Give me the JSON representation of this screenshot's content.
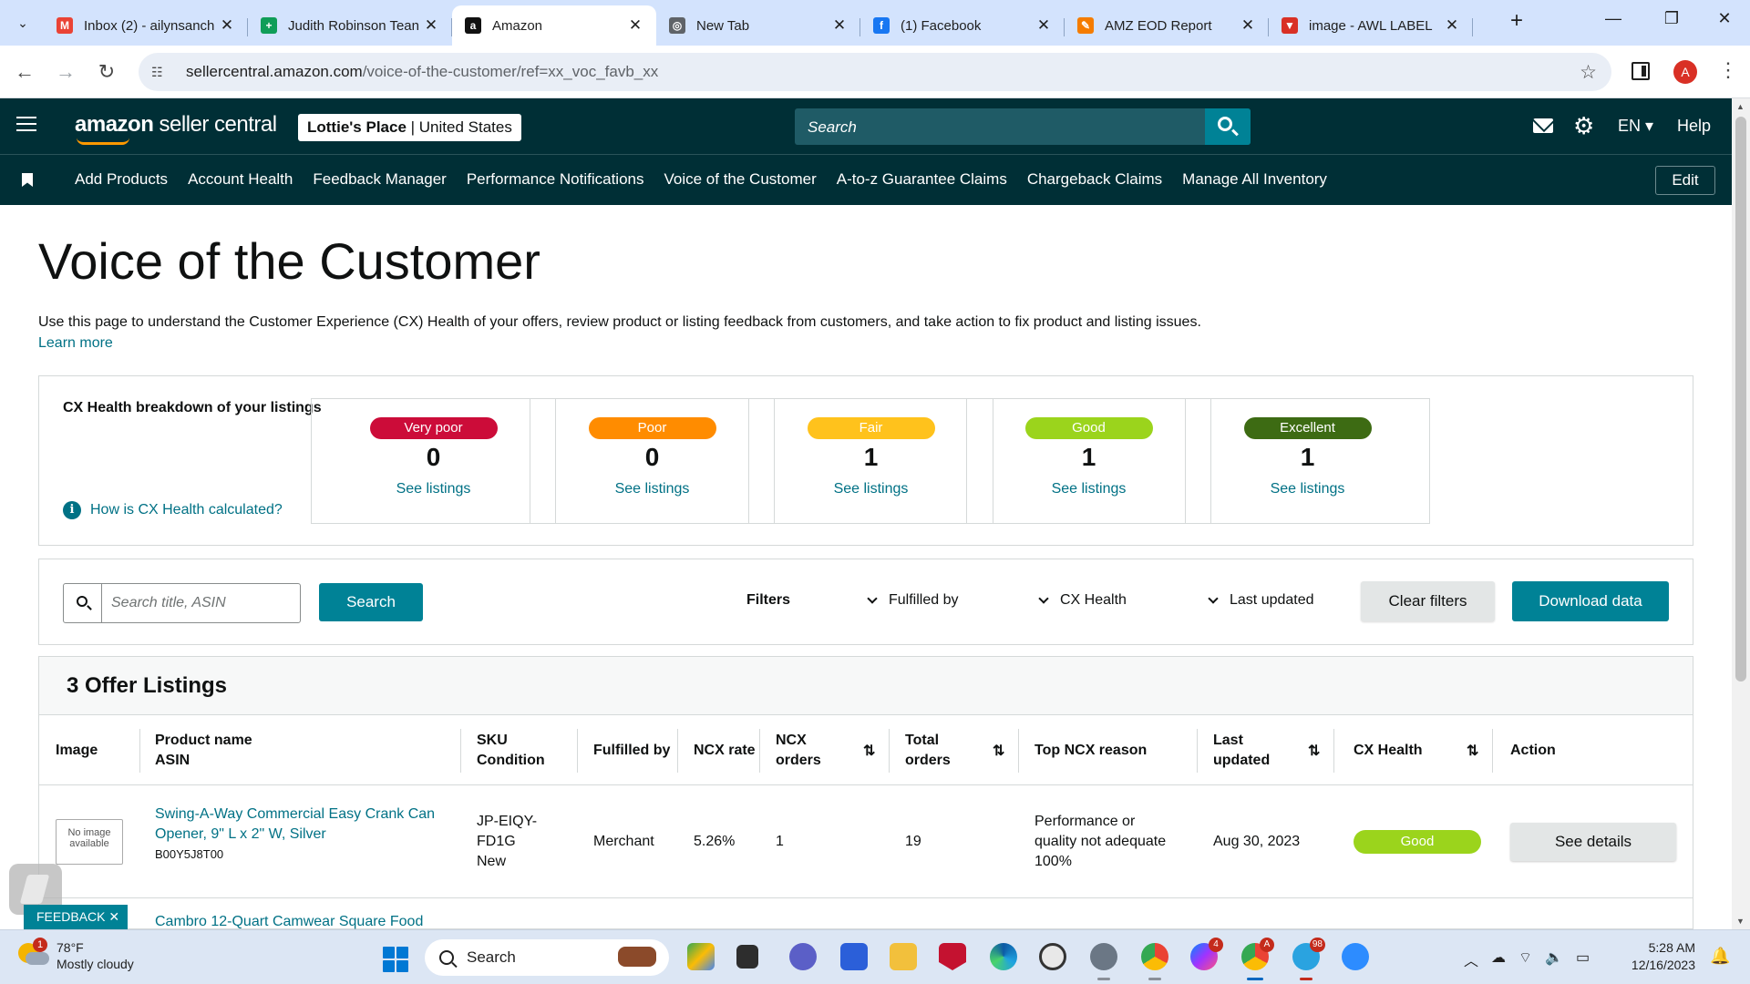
{
  "browser": {
    "tabs": [
      {
        "title": "Inbox (2) - ailynsanch",
        "favicon": "gmail-icon",
        "color": "#ea4335",
        "glyph": "M",
        "active": false
      },
      {
        "title": "Judith Robinson Tean",
        "favicon": "sheets-icon",
        "color": "#0f9d58",
        "glyph": "+",
        "active": false
      },
      {
        "title": "Amazon",
        "favicon": "amazon-icon",
        "color": "#111111",
        "glyph": "a",
        "active": true
      },
      {
        "title": "New Tab",
        "favicon": "chrome-icon",
        "color": "#5f6368",
        "glyph": "◎",
        "active": false
      },
      {
        "title": "(1) Facebook",
        "favicon": "facebook-icon",
        "color": "#1877f2",
        "glyph": "f",
        "active": false
      },
      {
        "title": "AMZ EOD Report",
        "favicon": "tool-icon",
        "color": "#f57c00",
        "glyph": "✎",
        "active": false
      },
      {
        "title": "image - AWL LABEL",
        "favicon": "drive-icon",
        "color": "#d93025",
        "glyph": "▼",
        "active": false
      }
    ],
    "url_host": "sellercentral.amazon.com",
    "url_path": "/voice-of-the-customer/ref=xx_voc_favb_xx",
    "profile_initial": "A"
  },
  "header": {
    "logo_brand": "amazon",
    "logo_rest": " seller central",
    "store_name": "Lottie's Place",
    "store_region": " | United States",
    "search_placeholder": "Search",
    "language": "EN ▾",
    "help": "Help"
  },
  "subnav": {
    "items": [
      "Add Products",
      "Account Health",
      "Feedback Manager",
      "Performance Notifications",
      "Voice of the Customer",
      "A-to-z Guarantee Claims",
      "Chargeback Claims",
      "Manage All Inventory"
    ],
    "edit": "Edit"
  },
  "page": {
    "title": "Voice of the Customer",
    "intro": "Use this page to understand the Customer Experience (CX) Health of your offers, review product or listing feedback from customers, and take action to fix product and listing issues.",
    "learn_more": "Learn more"
  },
  "health": {
    "title": "CX Health breakdown of your listings",
    "help_link": "How is CX Health calculated?",
    "cards": [
      {
        "label": "Very poor",
        "count": "0",
        "link": "See listings",
        "color": "#cc0c39"
      },
      {
        "label": "Poor",
        "count": "0",
        "link": "See listings",
        "color": "#ff8c00"
      },
      {
        "label": "Fair",
        "count": "1",
        "link": "See listings",
        "color": "#ffc21c"
      },
      {
        "label": "Good",
        "count": "1",
        "link": "See listings",
        "color": "#9bd41c"
      },
      {
        "label": "Excellent",
        "count": "1",
        "link": "See listings",
        "color": "#3d6b13"
      }
    ]
  },
  "filters": {
    "search_placeholder": "Search title, ASIN",
    "search_button": "Search",
    "label": "Filters",
    "dropdowns": [
      "Fulfilled by",
      "CX Health",
      "Last updated"
    ],
    "clear": "Clear filters",
    "download": "Download data"
  },
  "listings": {
    "count_title": "3 Offer Listings",
    "columns": {
      "image": "Image",
      "product_name": "Product name",
      "asin": "ASIN",
      "sku": "SKU",
      "condition": "Condition",
      "fulfilled_by": "Fulfilled by",
      "ncx_rate": "NCX rate",
      "ncx_orders_1": "NCX",
      "ncx_orders_2": "orders",
      "total_orders_1": "Total",
      "total_orders_2": "orders",
      "top_reason": "Top NCX reason",
      "last_updated_1": "Last",
      "last_updated_2": "updated",
      "cx_health": "CX Health",
      "action": "Action"
    },
    "rows": [
      {
        "image_text_1": "No image",
        "image_text_2": "available",
        "name_1": "Swing-A-Way Commercial Easy Crank Can",
        "name_2": "Opener, 9\" L x 2\" W, Silver",
        "asin": "B00Y5J8T00",
        "sku_1": "JP-EIQY-",
        "sku_2": "FD1G",
        "condition": "New",
        "fulfilled_by": "Merchant",
        "ncx_rate": "5.26%",
        "ncx_orders": "1",
        "total_orders": "19",
        "reason_1": "Performance or",
        "reason_2": "quality not adequate",
        "reason_pct": "100%",
        "last_updated": "Aug 30, 2023",
        "cx_health": "Good",
        "action": "See details"
      }
    ],
    "partial_row_name": "Cambro 12-Quart Camwear Square Food"
  },
  "feedback_tag": "FEEDBACK ✕",
  "taskbar": {
    "weather_temp": "78°F",
    "weather_desc": "Mostly cloudy",
    "weather_badge": "1",
    "search": "Search",
    "messenger_badge": "4",
    "chrome_badge": "A",
    "telegram_badge": "98",
    "time": "5:28 AM",
    "date": "12/16/2023"
  }
}
